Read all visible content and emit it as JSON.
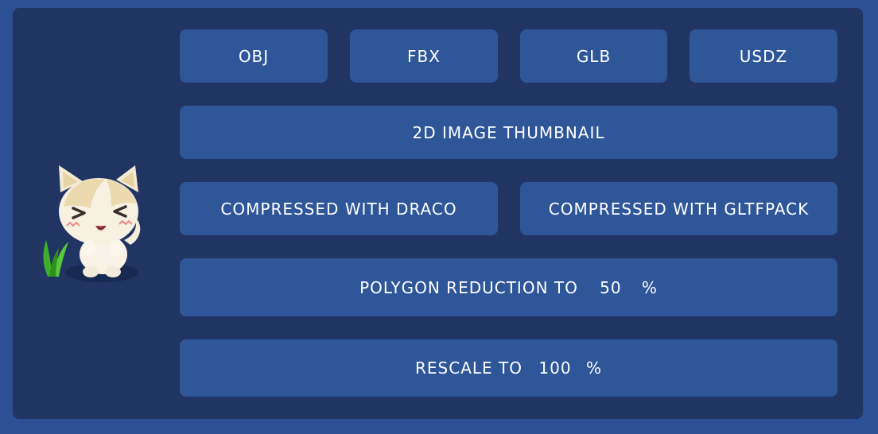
{
  "formats": {
    "obj": "OBJ",
    "fbx": "FBX",
    "glb": "GLB",
    "usdz": "USDZ"
  },
  "thumbnail_label": "2D IMAGE THUMBNAIL",
  "compression": {
    "draco": "COMPRESSED WITH DRACO",
    "gltfpack": "COMPRESSED WITH GLTFPACK"
  },
  "polygon_reduction": {
    "label": "POLYGON REDUCTION TO",
    "value": "50",
    "unit": "%"
  },
  "rescale": {
    "label": "RESCALE TO",
    "value": "100",
    "unit": "%"
  },
  "preview": {
    "subject": "cat-character-model-preview"
  },
  "colors": {
    "page_background": "#2c4f96",
    "panel_background": "#213563",
    "button_background": "#2e5699",
    "button_text": "#ffffff"
  }
}
